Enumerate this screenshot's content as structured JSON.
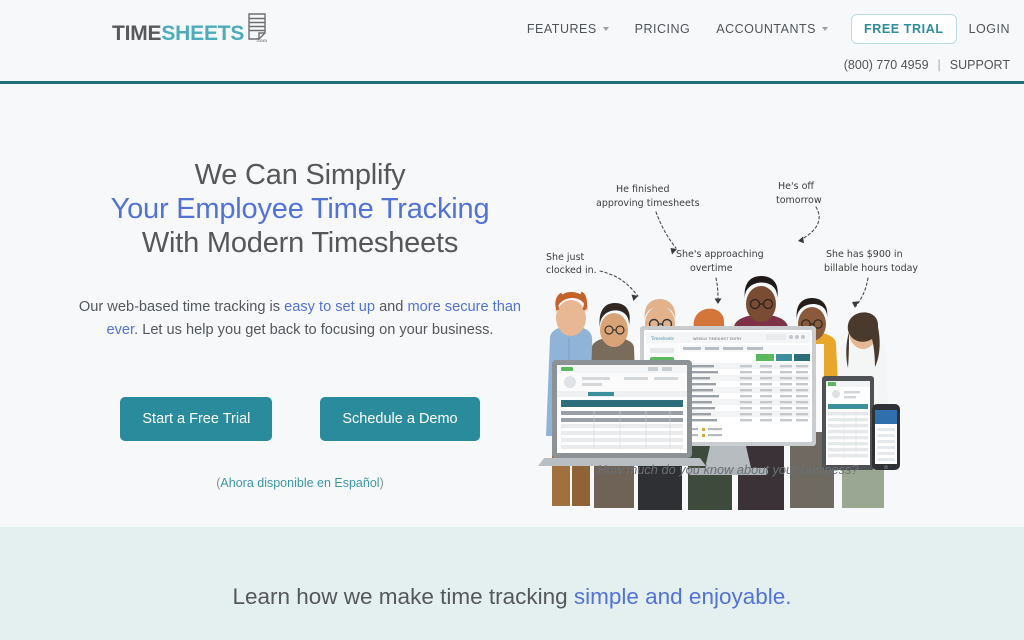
{
  "header": {
    "logo": {
      "part1": "TIME",
      "part2": "SHEETS",
      "suffix": ".com",
      "mark_icon": "stacked-sheets-icon"
    },
    "nav": [
      {
        "label": "FEATURES",
        "has_dropdown": true
      },
      {
        "label": "PRICING",
        "has_dropdown": false
      },
      {
        "label": "ACCOUNTANTS",
        "has_dropdown": true
      }
    ],
    "free_trial": "FREE TRIAL",
    "login": "LOGIN",
    "phone": "(800) 770 4959",
    "separator": "|",
    "support": "SUPPORT",
    "accent_color": "#22707e"
  },
  "hero": {
    "headline": {
      "line1": "We Can Simplify",
      "line2": "Your Employee Time Tracking",
      "line3": "With Modern Timesheets"
    },
    "subtext": {
      "seg1": "Our web-based time tracking is ",
      "link1": "easy to set up",
      "seg2": " and ",
      "link2": "more secure than ever",
      "seg3": ". Let us help you get back to focusing on your business."
    },
    "primary_cta": "Start a Free Trial",
    "secondary_cta": "Schedule a Demo",
    "spanish_open": "(",
    "spanish_link": "Ahora disponible en Español",
    "spanish_close": ")",
    "caption": "How much do you know about your business?",
    "annotations": [
      {
        "text": "She just clocked in.",
        "id": "annotation-clocked-in"
      },
      {
        "text": "He finished approving timesheets",
        "id": "annotation-approving-timesheets"
      },
      {
        "text": "She's approaching overtime",
        "id": "annotation-approaching-overtime"
      },
      {
        "text": "He's off tomorrow",
        "id": "annotation-off-tomorrow"
      },
      {
        "text": "She has $900 in billable hours today",
        "id": "annotation-billable-hours"
      }
    ],
    "devices": [
      "laptop",
      "desktop-monitor",
      "tablet",
      "phone"
    ],
    "button_color": "#2a8b9d",
    "blue_color": "#5372d6",
    "background": "#f7f8f9"
  },
  "band": {
    "text_part1": "Learn how we make time tracking ",
    "text_part2": "simple and enjoyable.",
    "background": "#e4f0f0"
  }
}
